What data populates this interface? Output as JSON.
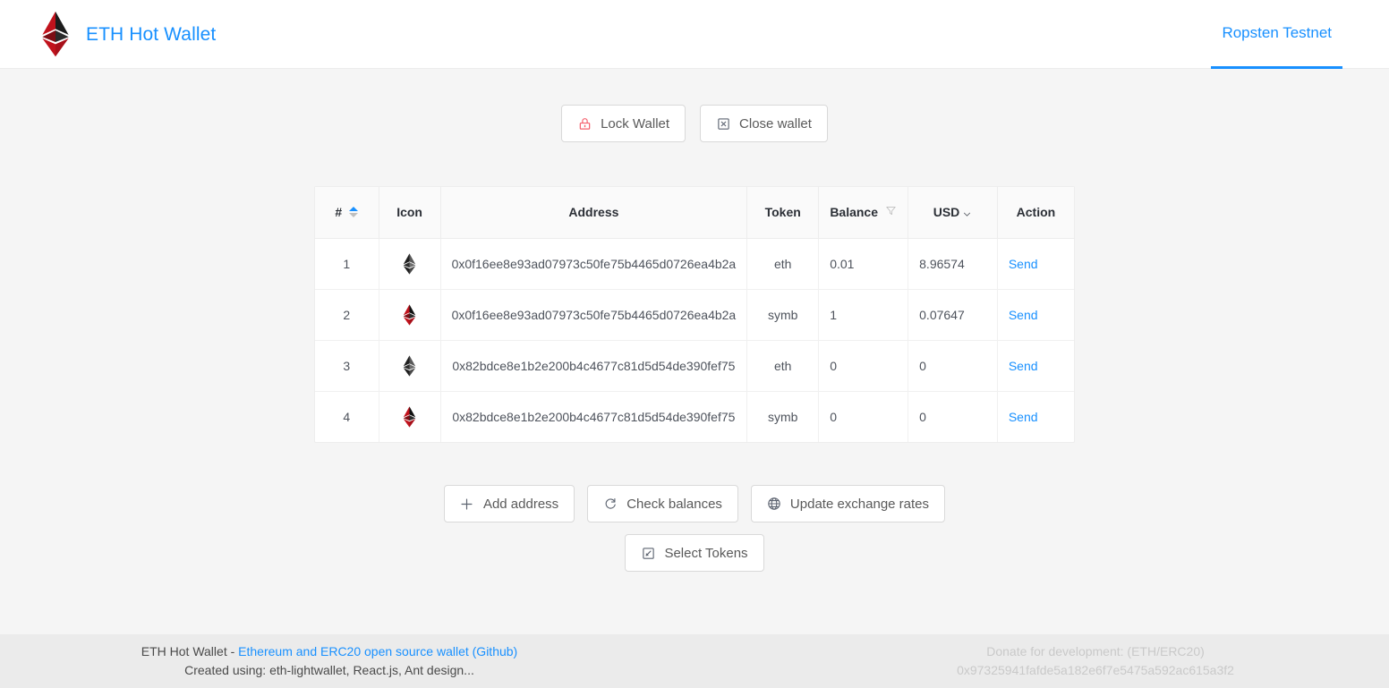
{
  "header": {
    "brand_title": "ETH Hot Wallet",
    "logo_icon": "ethereum-diamond-icon",
    "nav_tab_label": "Ropsten Testnet",
    "accent_color": "#1890ff"
  },
  "toolbar": {
    "lock_label": "Lock Wallet",
    "lock_icon": "lock-icon",
    "lock_icon_color": "#f5606d",
    "close_label": "Close wallet",
    "close_icon": "close-square-icon"
  },
  "table": {
    "columns": [
      {
        "key": "num",
        "label": "#",
        "icon": "caret-sorter-icon"
      },
      {
        "key": "icon",
        "label": "Icon",
        "icon": ""
      },
      {
        "key": "addr",
        "label": "Address",
        "icon": ""
      },
      {
        "key": "token",
        "label": "Token",
        "icon": ""
      },
      {
        "key": "bal",
        "label": "Balance",
        "icon": "filter-funnel-icon"
      },
      {
        "key": "usd",
        "label": "USD",
        "icon": "chevron-down-icon"
      },
      {
        "key": "act",
        "label": "Action",
        "icon": ""
      }
    ],
    "rows": [
      {
        "num": "1",
        "icon": "ethereum-diamond-icon-dark",
        "address": "0x0f16ee8e93ad07973c50fe75b4465d0726ea4b2a",
        "token": "eth",
        "balance": "0.01",
        "usd": "8.96574",
        "action": "Send"
      },
      {
        "num": "2",
        "icon": "ethereum-diamond-icon-red",
        "address": "0x0f16ee8e93ad07973c50fe75b4465d0726ea4b2a",
        "token": "symb",
        "balance": "1",
        "usd": "0.07647",
        "action": "Send"
      },
      {
        "num": "3",
        "icon": "ethereum-diamond-icon-dark",
        "address": "0x82bdce8e1b2e200b4c4677c81d5d54de390fef75",
        "token": "eth",
        "balance": "0",
        "usd": "0",
        "action": "Send"
      },
      {
        "num": "4",
        "icon": "ethereum-diamond-icon-red",
        "address": "0x82bdce8e1b2e200b4c4677c81d5d54de390fef75",
        "token": "symb",
        "balance": "0",
        "usd": "0",
        "action": "Send"
      }
    ]
  },
  "actions": {
    "add_address_label": "Add address",
    "add_address_icon": "plus-icon",
    "check_balances_label": "Check balances",
    "check_balances_icon": "reload-icon",
    "update_rates_label": "Update exchange rates",
    "update_rates_icon": "globe-icon",
    "select_tokens_label": "Select Tokens",
    "select_tokens_icon": "select-box-icon"
  },
  "footer": {
    "left_prefix": "ETH Hot Wallet - ",
    "left_link": "Ethereum and ERC20 open source wallet (Github)",
    "left_line2": "Created using: eth-lightwallet, React.js, Ant design...",
    "right_line1": "Donate for development: (ETH/ERC20)",
    "right_line2": "0x97325941fafde5a182e6f7e5475a592ac615a3f2"
  }
}
